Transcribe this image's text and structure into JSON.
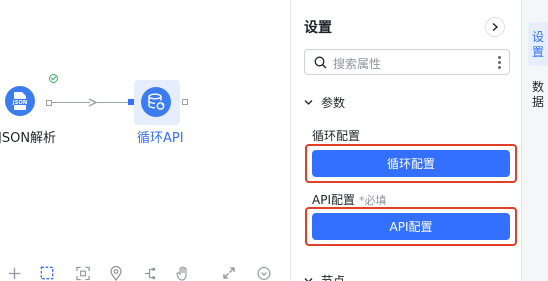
{
  "canvas": {
    "nodes": [
      {
        "id": "json",
        "label": "JSON解析",
        "icon_text": "JSON",
        "icon": "json-file-icon",
        "status": "success"
      },
      {
        "id": "loop",
        "label": "循环API",
        "icon": "database-loop-icon",
        "selected": true
      }
    ],
    "toolbar": {
      "icons": [
        "plus-icon",
        "select-box-icon",
        "fit-view-icon",
        "locate-icon",
        "layout-tree-icon",
        "hand-pan-icon",
        "expand-icon",
        "chevron-down-circle-icon"
      ]
    }
  },
  "panel": {
    "title": "设置",
    "search_placeholder": "搜索属性",
    "section_params": "参数",
    "loop_config_label": "循环配置",
    "loop_config_button": "循环配置",
    "api_config_label": "API配置",
    "api_config_required": "*必填",
    "api_config_button": "API配置",
    "section_next": "节点"
  },
  "rail": {
    "tabs": [
      {
        "label": "设置",
        "active": true
      },
      {
        "label": "数据",
        "active": false
      }
    ]
  },
  "colors": {
    "accent": "#3370ff",
    "node_icon": "#3b7cf0",
    "highlight_border": "#e0402a",
    "success": "#2fb36b"
  }
}
